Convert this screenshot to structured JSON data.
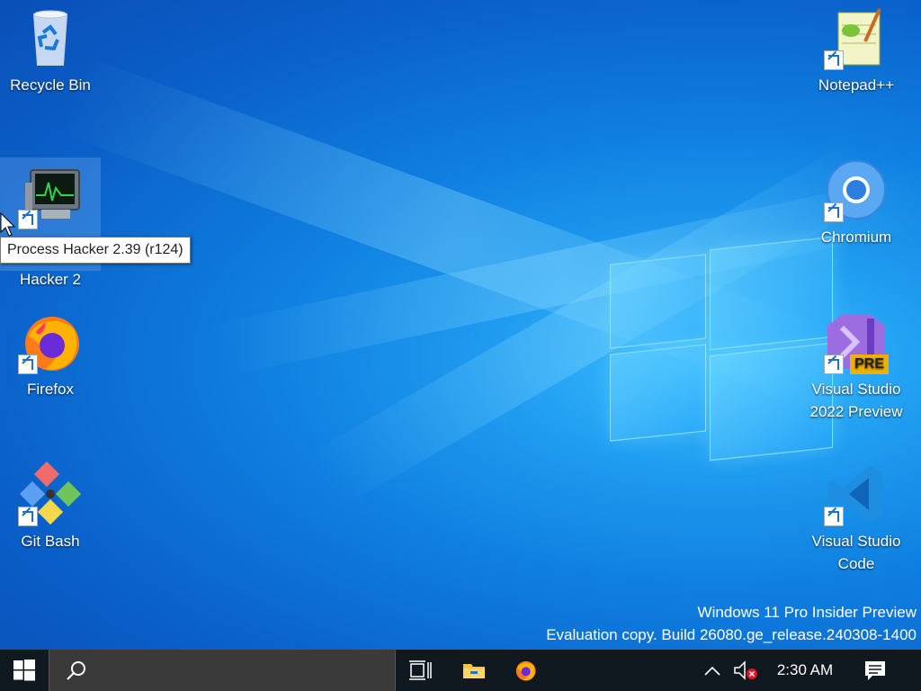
{
  "desktop": {
    "icons": [
      {
        "label": "Recycle Bin"
      },
      {
        "label": "Process Hacker 2"
      },
      {
        "label": "Firefox"
      },
      {
        "label": "Git Bash"
      },
      {
        "label": "Notepad++"
      },
      {
        "label": "Chromium"
      },
      {
        "label": "Visual Studio 2022 Preview",
        "badge": "PRE"
      },
      {
        "label": "Visual Studio Code"
      }
    ],
    "tooltip": "Process Hacker 2.39 (r124)",
    "watermark": {
      "line1": "Windows 11 Pro Insider Preview",
      "line2": "Evaluation copy. Build 26080.ge_release.240308-1400"
    }
  },
  "taskbar": {
    "clock": "2:30 AM",
    "icons": [
      "windows-start-icon",
      "search-icon",
      "task-view-icon",
      "file-explorer-icon",
      "firefox-icon",
      "chevron-up-icon",
      "speaker-muted-icon",
      "notification-icon"
    ]
  },
  "colors": {
    "taskbar": "#101820",
    "search_box": "#3a3a3a",
    "desktop_accent": "#1f9cf0"
  }
}
